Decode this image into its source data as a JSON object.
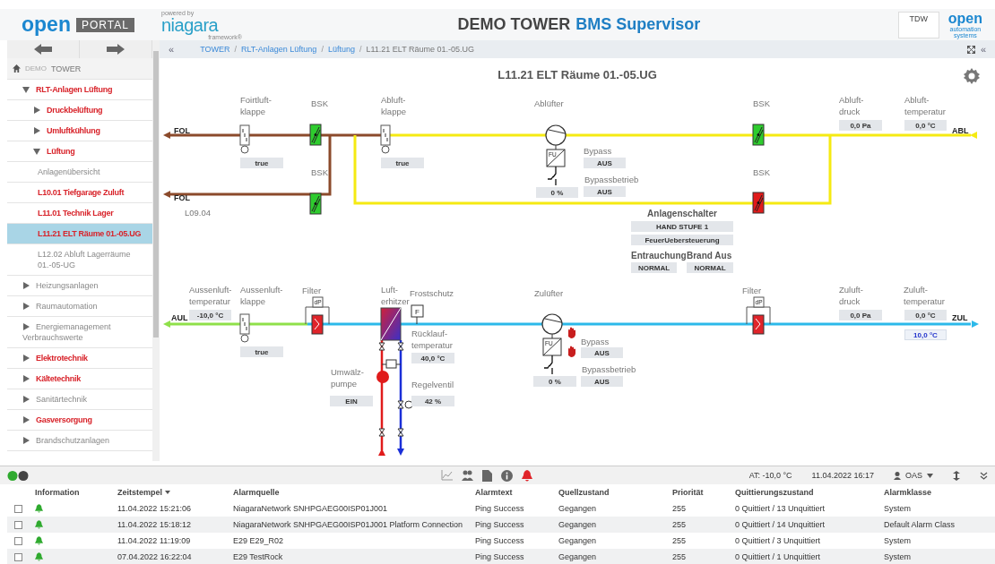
{
  "header": {
    "logo_word": "open",
    "logo_tag": "PORTAL",
    "powered": "powered by",
    "framework_name": "niagara",
    "framework_sub": "framework®",
    "title_main": "DEMO TOWER",
    "title_sub": "BMS Supervisor",
    "partner": "TDW",
    "brand_word": "open",
    "brand_line1": "automation",
    "brand_line2": "systems"
  },
  "sidebar": {
    "home": {
      "prefix": "DEMO",
      "label": "TOWER"
    },
    "tree": [
      {
        "label": "RLT-Anlagen Lüftung",
        "alarm": true,
        "expanded": true,
        "children": [
          {
            "label": "Druckbelüftung",
            "alarm": true,
            "expanded": false
          },
          {
            "label": "Umluftkühlung",
            "alarm": true,
            "expanded": false
          },
          {
            "label": "Lüftung",
            "alarm": true,
            "expanded": true,
            "children": [
              {
                "label": "Anlagenübersicht",
                "alarm": false,
                "selected": false
              },
              {
                "label": "L10.01 Tiefgarage Zuluft",
                "alarm": true,
                "selected": false
              },
              {
                "label": "L11.01 Technik Lager",
                "alarm": true,
                "selected": false
              },
              {
                "label": "L11.21 ELT Räume 01.-05.UG",
                "alarm": true,
                "selected": true
              },
              {
                "label": "L12.02 Abluft Lagerräume 01.-05-UG",
                "alarm": false,
                "selected": false
              }
            ]
          }
        ]
      },
      {
        "label": "Heizungsanlagen",
        "alarm": false,
        "expanded": false
      },
      {
        "label": "Raumautomation",
        "alarm": false,
        "expanded": false
      },
      {
        "label": "Energiemanagement Verbrauchswerte",
        "alarm": false,
        "expanded": false
      },
      {
        "label": "Elektrotechnik",
        "alarm": true,
        "expanded": false
      },
      {
        "label": "Kältetechnik",
        "alarm": true,
        "expanded": false
      },
      {
        "label": "Sanitärtechnik",
        "alarm": false,
        "expanded": false
      },
      {
        "label": "Gasversorgung",
        "alarm": true,
        "expanded": false
      },
      {
        "label": "Brandschutzanlagen",
        "alarm": false,
        "expanded": false
      }
    ]
  },
  "breadcrumb": {
    "toggle": "«",
    "separator": "/",
    "items": [
      "TOWER",
      "RLT-Anlagen Lüftung",
      "Lüftung",
      "L11.21 ELT Räume 01.-05.UG"
    ],
    "collapse": "«"
  },
  "diagram": {
    "title": "L11.21 ELT Räume 01.-05.UG",
    "labels": [
      {
        "text": "Foirtluft-\nklappe",
        "kind": "label"
      },
      {
        "text": "BSK",
        "kind": "label"
      },
      {
        "text": "Abluft-\nklappe",
        "kind": "label"
      },
      {
        "text": "Ablüfter",
        "kind": "label"
      },
      {
        "text": "BSK",
        "kind": "label"
      },
      {
        "text": "Abluft-\ndruck",
        "kind": "label"
      },
      {
        "text": "Abluft-\ntemperatur",
        "kind": "label"
      },
      {
        "text": "FOL",
        "kind": "pipe"
      },
      {
        "text": "Bypass",
        "kind": "label"
      },
      {
        "text": "BSK",
        "kind": "label"
      },
      {
        "text": "BSK",
        "kind": "label"
      },
      {
        "text": "Bypassbetrieb",
        "kind": "label"
      },
      {
        "text": "FOL",
        "kind": "pipe"
      },
      {
        "text": "L09.04",
        "kind": "label"
      },
      {
        "text": "Anlagenschalter",
        "kind": "heading"
      },
      {
        "text": "Entrauchung",
        "kind": "heading"
      },
      {
        "text": "Brand Aus",
        "kind": "heading"
      },
      {
        "text": "ABL",
        "kind": "pipe"
      },
      {
        "text": "Aussenluft-\ntemperatur",
        "kind": "label"
      },
      {
        "text": "Aussenluft-\nklappe",
        "kind": "label"
      },
      {
        "text": "Filter",
        "kind": "label"
      },
      {
        "text": "Luft-\nerhitzer",
        "kind": "label"
      },
      {
        "text": "Frostschutz",
        "kind": "label"
      },
      {
        "text": "Zulüfter",
        "kind": "label"
      },
      {
        "text": "Filter",
        "kind": "label"
      },
      {
        "text": "Zuluft-\ndruck",
        "kind": "label"
      },
      {
        "text": "Zuluft-\ntemperatur",
        "kind": "label"
      },
      {
        "text": "AUL",
        "kind": "pipe"
      },
      {
        "text": "ZUL",
        "kind": "pipe"
      },
      {
        "text": "Rücklauf-\ntemperatur",
        "kind": "label"
      },
      {
        "text": "Bypass",
        "kind": "label"
      },
      {
        "text": "Bypassbetrieb",
        "kind": "label"
      },
      {
        "text": "Umwälz-\npumpe",
        "kind": "label"
      },
      {
        "text": "Regelventil",
        "kind": "label"
      }
    ],
    "values": [
      {
        "text": "true",
        "kind": "reading"
      },
      {
        "text": "true",
        "kind": "reading"
      },
      {
        "text": "AUS",
        "kind": "reading"
      },
      {
        "text": "0,0 Pa",
        "kind": "reading"
      },
      {
        "text": "0,0 °C",
        "kind": "reading"
      },
      {
        "text": "0 %",
        "kind": "reading"
      },
      {
        "text": "AUS",
        "kind": "reading"
      },
      {
        "text": "HAND STUFE 1",
        "kind": "reading"
      },
      {
        "text": "FeuerUebersteuerung",
        "kind": "reading"
      },
      {
        "text": "NORMAL",
        "kind": "reading"
      },
      {
        "text": "NORMAL",
        "kind": "reading"
      },
      {
        "text": "-10,0 °C",
        "kind": "reading"
      },
      {
        "text": "0,0 Pa",
        "kind": "reading"
      },
      {
        "text": "0,0 °C",
        "kind": "reading"
      },
      {
        "text": "10,0 °C",
        "kind": "setpoint"
      },
      {
        "text": "true",
        "kind": "reading"
      },
      {
        "text": "AUS",
        "kind": "reading"
      },
      {
        "text": "40,0 °C",
        "kind": "reading"
      },
      {
        "text": "0 %",
        "kind": "reading"
      },
      {
        "text": "AUS",
        "kind": "reading"
      },
      {
        "text": "EIN",
        "kind": "reading"
      },
      {
        "text": "42 %",
        "kind": "reading"
      }
    ],
    "fire_dampers": [
      {
        "color": "#2ecc2e"
      },
      {
        "color": "#2ecc2e"
      },
      {
        "color": "#2ecc2e"
      },
      {
        "color": "#e01b1b"
      }
    ],
    "filters": [
      {
        "symbol": "dP"
      },
      {
        "symbol": "dP"
      }
    ],
    "fans": [
      {
        "drive": "FU"
      },
      {
        "drive": "FU"
      }
    ],
    "frost_sensor": {
      "symbol": "F"
    }
  },
  "alarm_console": {
    "ambient": "AT: -10,0 °C",
    "datetime": "11.04.2022 16:17",
    "user": "OAS",
    "columns": [
      {
        "label": "Information",
        "sorted": false
      },
      {
        "label": "Zeitstempel",
        "sorted": true
      },
      {
        "label": "Alarmquelle",
        "sorted": false
      },
      {
        "label": "Alarmtext",
        "sorted": false
      },
      {
        "label": "Quellzustand",
        "sorted": false
      },
      {
        "label": "Priorität",
        "sorted": false
      },
      {
        "label": "Quittierungszustand",
        "sorted": false
      },
      {
        "label": "Alarmklasse",
        "sorted": false
      }
    ],
    "rows": [
      {
        "checked": false,
        "timestamp": "11.04.2022 15:21:06",
        "source": "NiagaraNetwork SNHPGAEG00ISP01J001",
        "text": "Ping Success",
        "state": "Gegangen",
        "priority": "255",
        "ack": "0 Quittiert / 13 Unquittiert",
        "class": "System"
      },
      {
        "checked": false,
        "timestamp": "11.04.2022 15:18:12",
        "source": "NiagaraNetwork SNHPGAEG00ISP01J001 Platform Connection",
        "text": "Ping Success",
        "state": "Gegangen",
        "priority": "255",
        "ack": "0 Quittiert / 14 Unquittiert",
        "class": "Default Alarm Class"
      },
      {
        "checked": false,
        "timestamp": "11.04.2022 11:19:09",
        "source": "E29 E29_R02",
        "text": "Ping Success",
        "state": "Gegangen",
        "priority": "255",
        "ack": "0 Quittiert / 3 Unquittiert",
        "class": "System"
      },
      {
        "checked": false,
        "timestamp": "07.04.2022 16:22:04",
        "source": "E29 TestRock",
        "text": "Ping Success",
        "state": "Gegangen",
        "priority": "255",
        "ack": "0 Quittiert / 1 Unquittiert",
        "class": "System"
      }
    ]
  }
}
